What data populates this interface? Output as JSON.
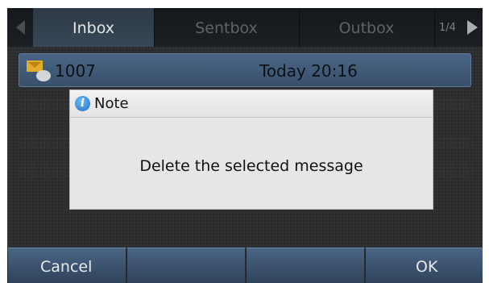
{
  "tabs": [
    {
      "label": "Inbox",
      "active": true
    },
    {
      "label": "Sentbox",
      "active": false
    },
    {
      "label": "Outbox",
      "active": false
    }
  ],
  "tab_page": "1/4",
  "message": {
    "sender": "1007",
    "time": "Today 20:16",
    "icon": "envelope-icon"
  },
  "dialog": {
    "title": "Note",
    "icon": "info-icon",
    "body": "Delete the selected message"
  },
  "softkeys": [
    {
      "label": "Cancel"
    },
    {
      "label": ""
    },
    {
      "label": ""
    },
    {
      "label": "OK"
    }
  ],
  "colors": {
    "active_tab": "#374858",
    "selected_row": "#4a6585",
    "dialog_bg": "#e6e6e6",
    "softkey": "#3d5470"
  }
}
